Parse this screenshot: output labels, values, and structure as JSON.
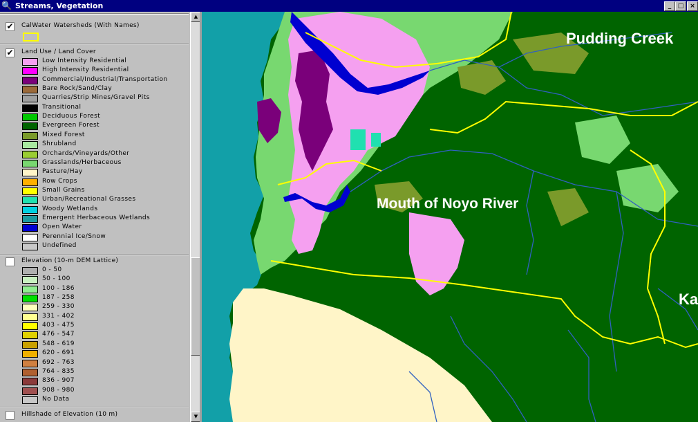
{
  "window": {
    "title": "Streams, Vegetation",
    "controls": [
      "_",
      "□",
      "×"
    ]
  },
  "toc": {
    "watersheds": {
      "name": "CalWater Watersheds (With Names)",
      "checked": true,
      "symbol_color": "#ffff00"
    },
    "landuse": {
      "name": "Land Use / Land Cover",
      "checked": true,
      "classes": [
        {
          "label": "Low Intensity Residential",
          "color": "#f5a0f0"
        },
        {
          "label": "High Intensity Residential",
          "color": "#ff00ff"
        },
        {
          "label": "Commercial/Industrial/Transportation",
          "color": "#7a007a"
        },
        {
          "label": "Bare Rock/Sand/Clay",
          "color": "#9b6a3a"
        },
        {
          "label": "Quarries/Strip Mines/Gravel Pits",
          "color": "#a0a0a0"
        },
        {
          "label": "Transitional",
          "color": "#000000"
        },
        {
          "label": "Deciduous Forest",
          "color": "#00c800"
        },
        {
          "label": "Evergreen Forest",
          "color": "#006400"
        },
        {
          "label": "Mixed Forest",
          "color": "#7a9a2a"
        },
        {
          "label": "Shrubland",
          "color": "#a8e8a0"
        },
        {
          "label": "Orchards/Vineyards/Other",
          "color": "#9acd32"
        },
        {
          "label": "Grasslands/Herbaceous",
          "color": "#78d870"
        },
        {
          "label": "Pasture/Hay",
          "color": "#fff5c8"
        },
        {
          "label": "Row Crops",
          "color": "#ffb000"
        },
        {
          "label": "Small Grains",
          "color": "#ffff00"
        },
        {
          "label": "Urban/Recreational Grasses",
          "color": "#20e0b0"
        },
        {
          "label": "Woody Wetlands",
          "color": "#00d0e0"
        },
        {
          "label": "Emergent Herbaceous Wetlands",
          "color": "#1a9aa0"
        },
        {
          "label": "Open Water",
          "color": "#0000d0"
        },
        {
          "label": "Perennial Ice/Snow",
          "color": "#ffffff"
        },
        {
          "label": "Undefined",
          "color": "#c8c8c8"
        }
      ]
    },
    "elevation": {
      "name": "Elevation (10-m DEM Lattice)",
      "checked": false,
      "classes": [
        {
          "label": "0 - 50",
          "color": "#b0b0b0"
        },
        {
          "label": "50 - 100",
          "color": "#c8f0c0"
        },
        {
          "label": "100 - 186",
          "color": "#90ee90"
        },
        {
          "label": "187 - 258",
          "color": "#00e000"
        },
        {
          "label": "259 - 330",
          "color": "#ffffc0"
        },
        {
          "label": "331 - 402",
          "color": "#ffff90"
        },
        {
          "label": "403 - 475",
          "color": "#ffff00"
        },
        {
          "label": "476 - 547",
          "color": "#e0d000"
        },
        {
          "label": "548 - 619",
          "color": "#c8a000"
        },
        {
          "label": "620 - 691",
          "color": "#f0b000"
        },
        {
          "label": "692 - 763",
          "color": "#d08040"
        },
        {
          "label": "764 - 835",
          "color": "#b06030"
        },
        {
          "label": "836 - 907",
          "color": "#8b3a3a"
        },
        {
          "label": "908 - 980",
          "color": "#a05050"
        },
        {
          "label": "No Data",
          "color": "#c8c8c8"
        }
      ]
    },
    "hillshade": {
      "name": "Hillshade of Elevation (10 m)",
      "checked": false
    }
  },
  "map": {
    "labels": {
      "pudding_creek": "Pudding Creek",
      "noyo": "Mouth of Noyo River",
      "ka": "Ka"
    },
    "colors": {
      "ocean": "#12a0a8",
      "evergreen": "#006400",
      "grassland": "#78d870",
      "mixed": "#7a9a2a",
      "residential": "#f5a0f0",
      "commercial": "#7a007a",
      "water": "#0000d0",
      "stream": "#3060c0",
      "watershed": "#ffff00",
      "pasture": "#fff5c8"
    }
  }
}
